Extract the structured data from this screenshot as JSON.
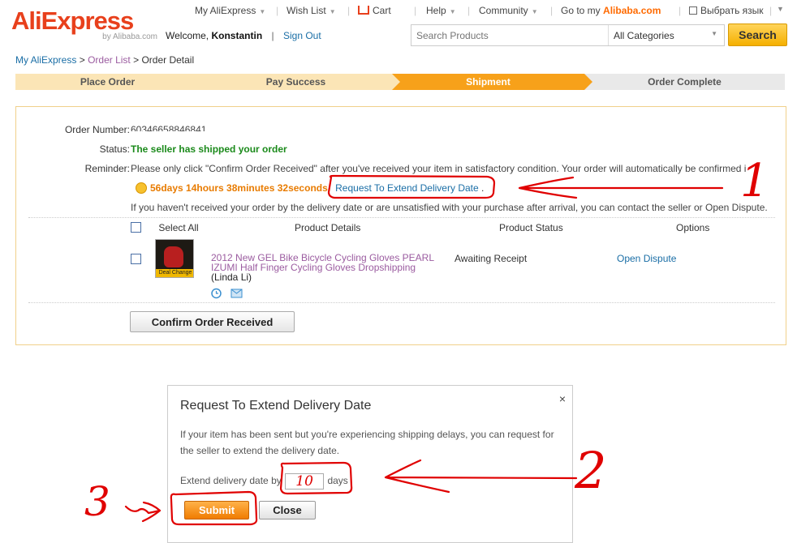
{
  "header": {
    "logo_text": "AliExpress",
    "logo_sub": "by Alibaba.com",
    "welcome_prefix": "Welcome,",
    "user_name": "Konstantin",
    "sign_out": "Sign Out",
    "nav": {
      "my_aliexpress": "My AliExpress",
      "wish_list": "Wish List",
      "cart": "Cart",
      "help": "Help",
      "community": "Community",
      "go_to": "Go to my",
      "alibaba": "Alibaba.com",
      "language": "Выбрать язык"
    },
    "search": {
      "placeholder": "Search Products",
      "category": "All Categories",
      "button": "Search"
    }
  },
  "breadcrumb": {
    "root": "My AliExpress",
    "sep": ">",
    "list": "Order List",
    "current": "Order Detail"
  },
  "steps": [
    "Place Order",
    "Pay Success",
    "Shipment",
    "Order Complete"
  ],
  "order": {
    "number_label": "Order Number:",
    "number_value": "60346658846841",
    "status_label": "Status:",
    "status_value": "The seller has shipped your order",
    "reminder_label": "Reminder:",
    "reminder_text": "Please only click \"Confirm Order Received\" after you've received your item in satisfactory condition. Your order will automatically be confirmed i",
    "countdown": "56days 14hours 38minutes 32seconds",
    "extend_link": "Request To Extend Delivery Date",
    "dispute_text": "If you haven't received your order by the delivery date or are unsatisfied with your purchase after arrival, you can contact the seller or Open Dispute.",
    "columns": {
      "select_all": "Select All",
      "details": "Product Details",
      "status": "Product Status",
      "options": "Options"
    },
    "item": {
      "title_line1": "2012 New GEL Bike Bicycle Cycling Gloves PEARL",
      "title_line2": "IZUMI Half Finger Cycling Gloves Dropshipping",
      "seller": "(Linda Li)",
      "status": "Awaiting Receipt",
      "option": "Open Dispute",
      "thumb_tag": "Deal Change"
    },
    "confirm_button": "Confirm Order Received"
  },
  "dialog": {
    "title": "Request To Extend Delivery Date",
    "close": "×",
    "text": "If your item has been sent but you're experiencing shipping delays, you can request for the seller to extend the delivery date.",
    "extend_prefix": "Extend delivery date by",
    "days_value": "10",
    "days_suffix": "days",
    "submit": "Submit",
    "close_button": "Close"
  },
  "annotations": {
    "n1": "1",
    "n2": "2",
    "n3": "3"
  },
  "colors": {
    "brand": "#e8401c",
    "accent": "#f7a11a",
    "link": "#1a6ea6",
    "annotation": "#e00000"
  }
}
